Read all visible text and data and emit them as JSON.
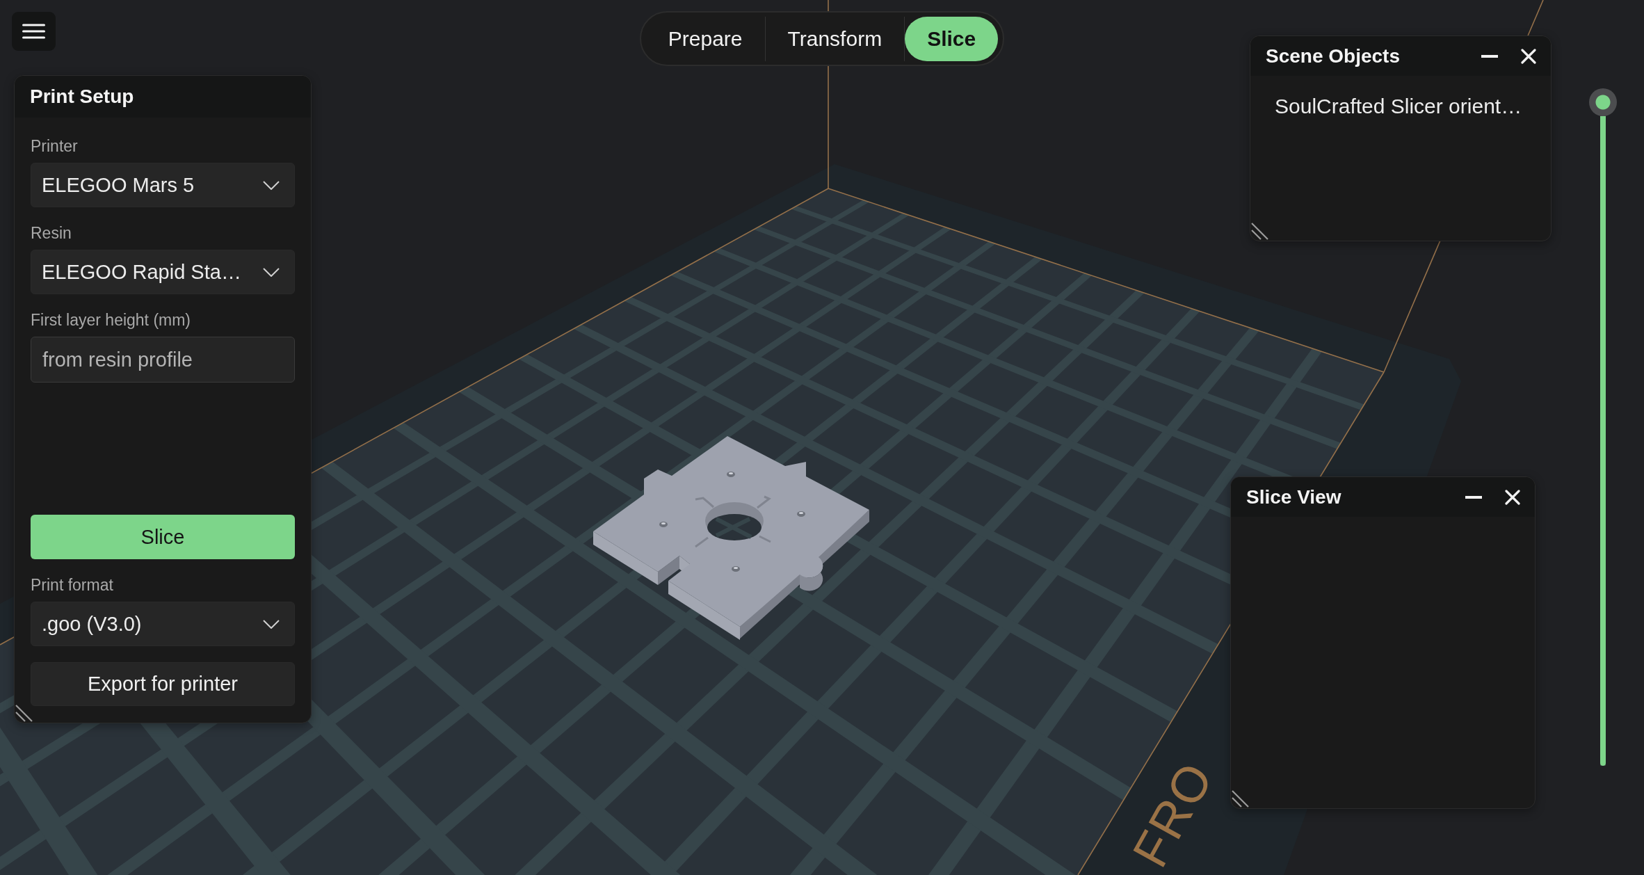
{
  "mode_tabs": [
    {
      "label": "Prepare",
      "selected": false
    },
    {
      "label": "Transform",
      "selected": false
    },
    {
      "label": "Slice",
      "selected": true
    }
  ],
  "print_setup": {
    "title": "Print Setup",
    "controls": [
      {
        "kind": "select",
        "label": "Printer",
        "value": "ELEGOO Mars 5"
      },
      {
        "kind": "select",
        "label": "Resin",
        "value": "ELEGOO Rapid Sta…"
      },
      {
        "kind": "input",
        "label": "First layer height (mm)",
        "placeholder": "from resin profile"
      },
      {
        "kind": "primary_button",
        "label": "Slice"
      },
      {
        "kind": "select",
        "label": "Print format",
        "value": ".goo (V3.0)"
      },
      {
        "kind": "button",
        "label": "Export for printer"
      }
    ]
  },
  "scene_objects": {
    "title": "Scene Objects",
    "items": [
      {
        "label": "SoulCrafted Slicer orient…",
        "selected": false
      }
    ]
  },
  "slice_view": {
    "title": "Slice View"
  },
  "layer_slider": {
    "level": 1
  },
  "viewport": {
    "plate_label": "FRO"
  }
}
